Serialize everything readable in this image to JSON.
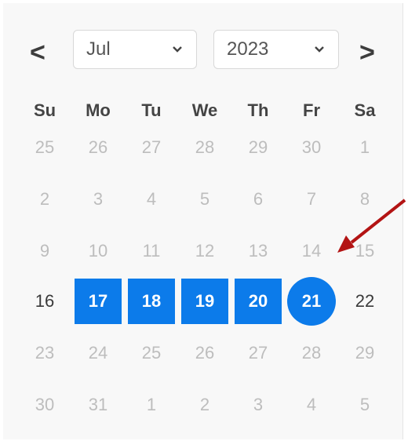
{
  "header": {
    "prev_label": "<",
    "next_label": ">",
    "month_value": "Jul",
    "year_value": "2023"
  },
  "weekdays": [
    "Su",
    "Mo",
    "Tu",
    "We",
    "Th",
    "Fr",
    "Sa"
  ],
  "weeks": [
    [
      "25",
      "26",
      "27",
      "28",
      "29",
      "30",
      "1"
    ],
    [
      "2",
      "3",
      "4",
      "5",
      "6",
      "7",
      "8"
    ],
    [
      "9",
      "10",
      "11",
      "12",
      "13",
      "14",
      "15"
    ],
    [
      "16",
      "17",
      "18",
      "19",
      "20",
      "21",
      "22"
    ],
    [
      "23",
      "24",
      "25",
      "26",
      "27",
      "28",
      "29"
    ],
    [
      "30",
      "31",
      "1",
      "2",
      "3",
      "4",
      "5"
    ]
  ],
  "selection": {
    "range_days": [
      "17",
      "18",
      "19",
      "20"
    ],
    "selected_day": "21"
  },
  "colors": {
    "accent": "#0c7bea",
    "annotation_arrow": "#b31414"
  },
  "icons": {
    "dropdown": "chevron-down-icon",
    "annotation": "red-arrow-icon"
  }
}
